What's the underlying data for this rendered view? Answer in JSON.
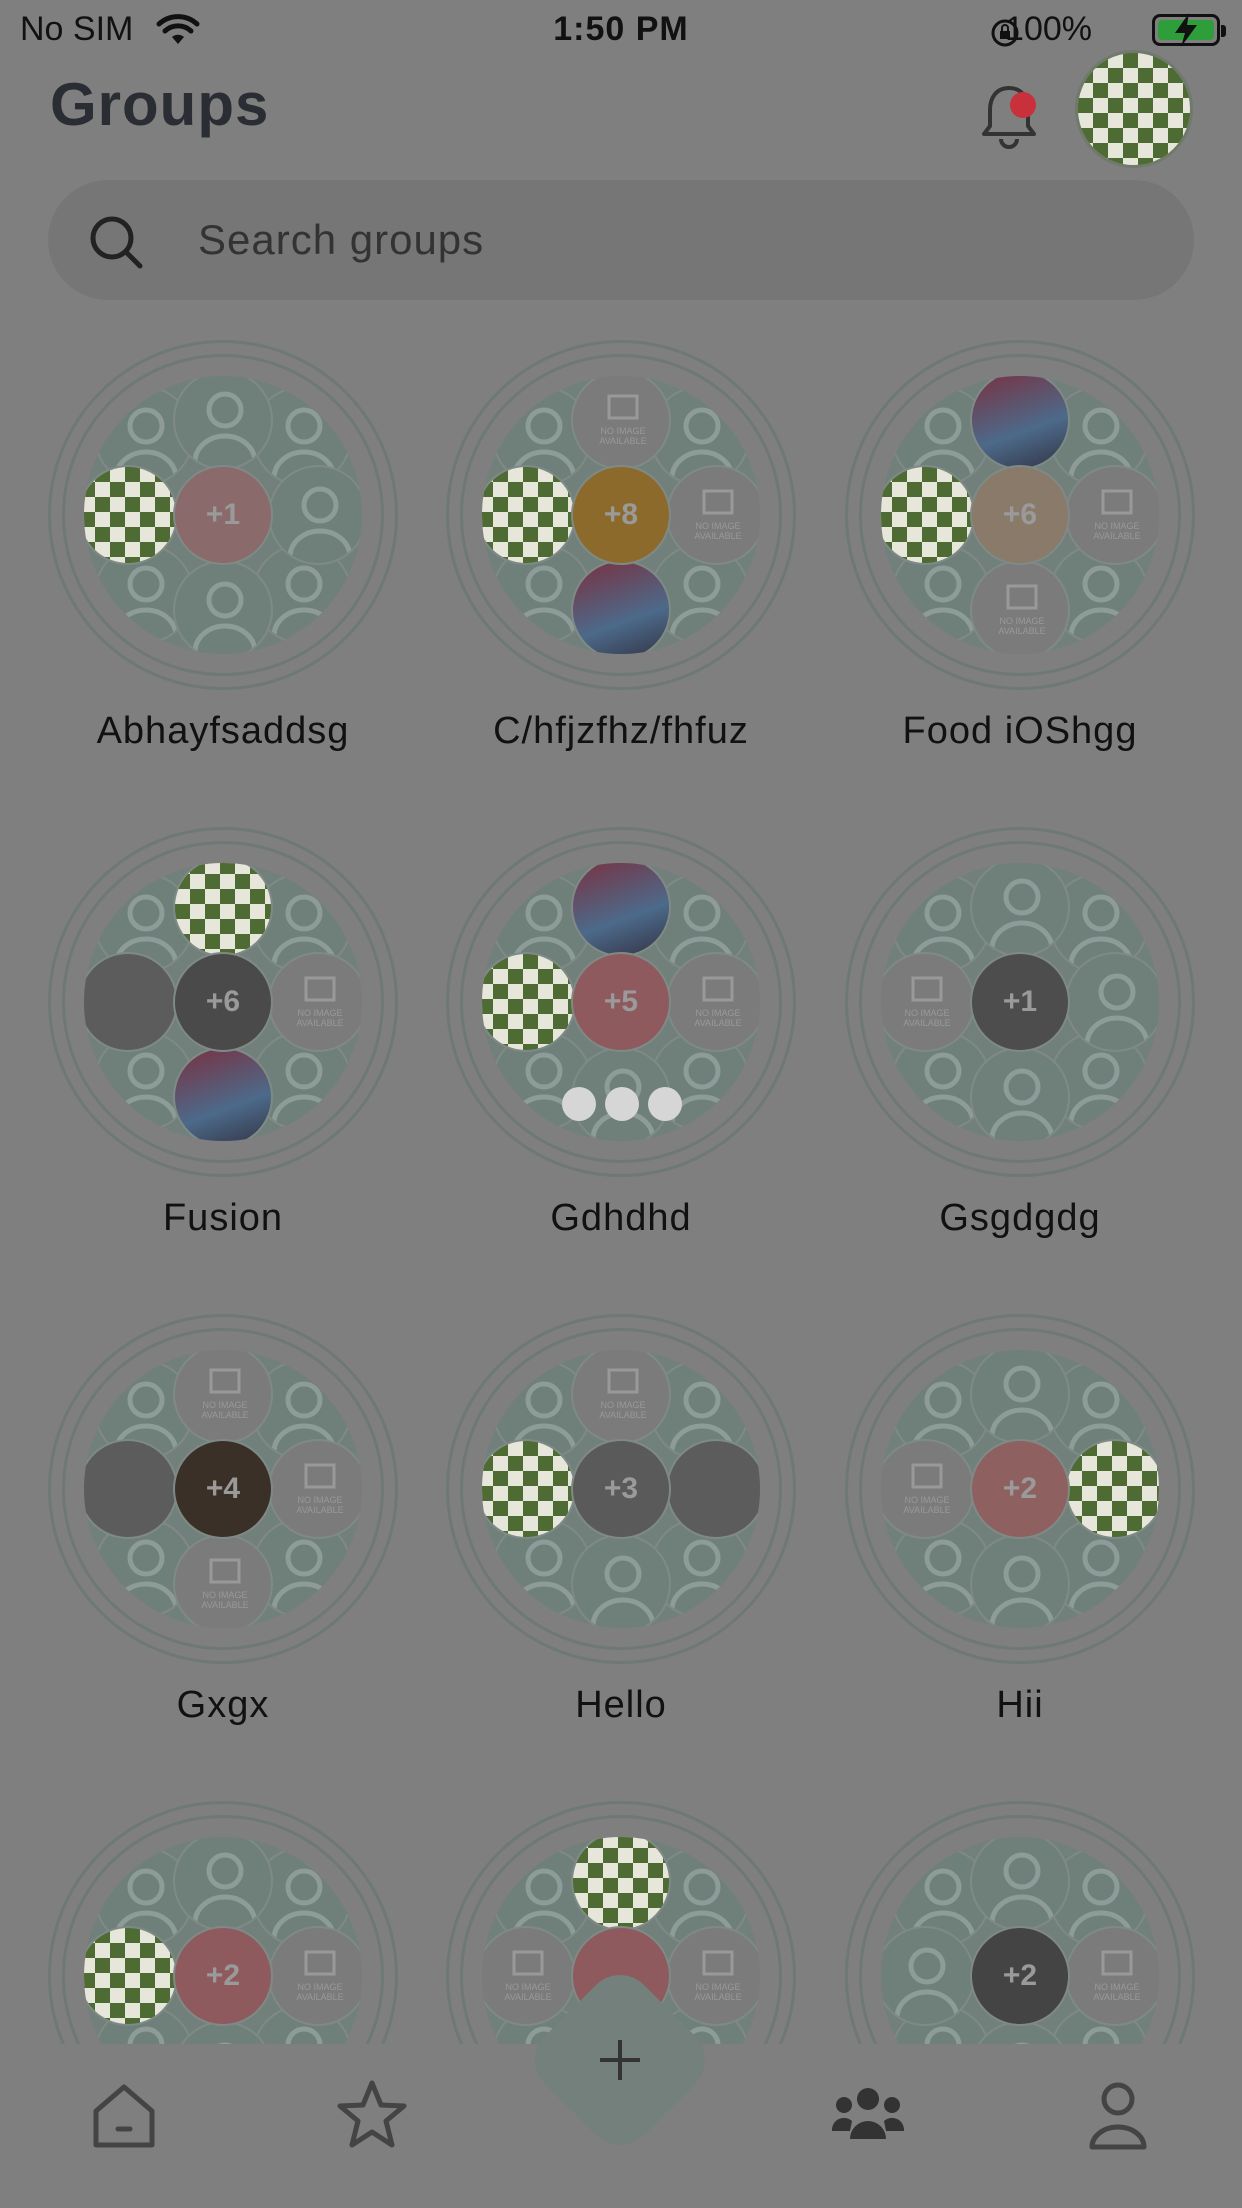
{
  "status_bar": {
    "carrier": "No SIM",
    "time": "1:50 PM",
    "battery": "100%"
  },
  "header": {
    "title": "Groups"
  },
  "search": {
    "placeholder": "Search groups"
  },
  "groups": [
    {
      "name": "Abhayfsaddsg",
      "more": "+1"
    },
    {
      "name": "C/hfjzfhz/fhfuz",
      "more": "+8"
    },
    {
      "name": "Food iOShgg",
      "more": "+6"
    },
    {
      "name": "Fusion",
      "more": "+6"
    },
    {
      "name": "Gdhdhd",
      "more": "+5"
    },
    {
      "name": "Gsgdgdg",
      "more": "+1"
    },
    {
      "name": "Gxgx",
      "more": "+4"
    },
    {
      "name": "Hello",
      "more": "+3"
    },
    {
      "name": "Hii",
      "more": "+2"
    },
    {
      "name": "",
      "more": "+2"
    },
    {
      "name": "",
      "more": ""
    },
    {
      "name": "",
      "more": "+2"
    }
  ],
  "tab_bar": {
    "items": [
      "home-icon",
      "star-icon",
      "add-icon",
      "groups-icon",
      "profile-icon"
    ],
    "active": "groups-icon"
  },
  "colors": {
    "overlay": "#7f7f7f",
    "notification_dot": "#c8313c",
    "battery_fill": "#2e9e3a"
  }
}
